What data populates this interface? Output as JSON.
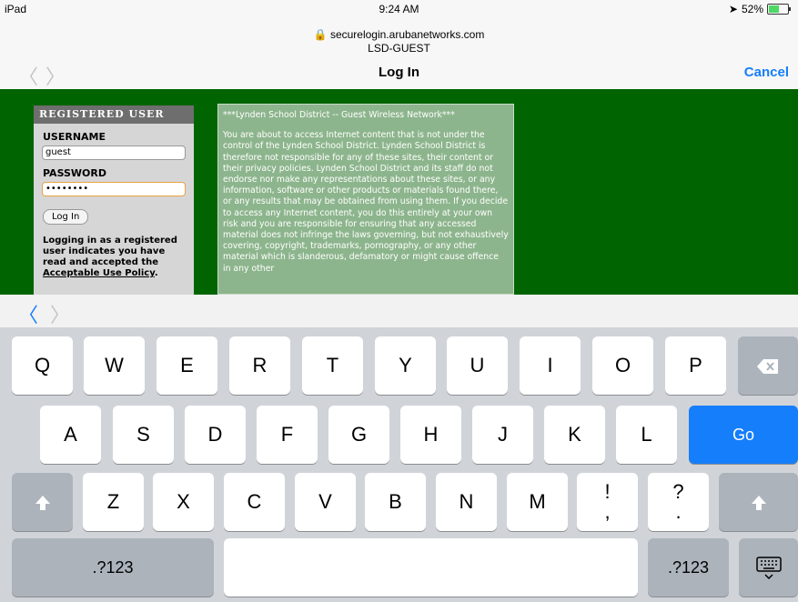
{
  "status": {
    "device": "iPad",
    "time": "9:24 AM",
    "battery": "52%",
    "battery_pct": 0.52
  },
  "url": {
    "host": "securelogin.arubanetworks.com",
    "network": "LSD-GUEST"
  },
  "nav": {
    "back": "〈",
    "forward": "〉",
    "title": "Log In",
    "cancel": "Cancel"
  },
  "login": {
    "header": "REGISTERED USER",
    "username_label": "USERNAME",
    "username_value": "guest",
    "password_label": "PASSWORD",
    "password_value": "••••••••",
    "button": "Log In",
    "info": "Logging in as a registered user indicates you have read and accepted the",
    "policy_link": "Acceptable Use Policy",
    "period": "."
  },
  "notice": {
    "title": "***Lynden School District -- Guest Wireless Network***",
    "body": "You are about to access Internet content that is not under the control of the Lynden School District. Lynden School District is therefore not responsible for any of these sites, their content or their privacy policies. Lynden School District and its staff do not endorse nor make any representations about these sites, or any information, software or other products or materials found there, or any results that may be obtained from using them. If you decide to access any Internet content, you do this entirely at your own risk and you are responsible for ensuring that any accessed material does not infringe the laws governing, but not exhaustively covering, copyright, trademarks, pornography, or any other material which is slanderous, defamatory or might cause offence in any other"
  },
  "accessory": {
    "prev": "〈",
    "next": "〉"
  },
  "keyboard": {
    "q": "Q",
    "w": "W",
    "e": "E",
    "r": "R",
    "t": "T",
    "y": "Y",
    "u": "U",
    "i": "I",
    "o": "O",
    "p": "P",
    "a": "A",
    "s": "S",
    "d": "D",
    "f": "F",
    "g": "G",
    "h": "H",
    "j": "J",
    "k": "K",
    "l": "L",
    "go": "Go",
    "z": "Z",
    "x": "X",
    "c": "C",
    "v": "V",
    "b": "B",
    "n": "N",
    "m": "M",
    "excl_top": "!",
    "excl_bot": ",",
    "quest_top": "?",
    "quest_bot": ".",
    "num_left": ".?123",
    "num_right": ".?123"
  },
  "colors": {
    "accent": "#157efb",
    "web_bg": "#006400"
  }
}
